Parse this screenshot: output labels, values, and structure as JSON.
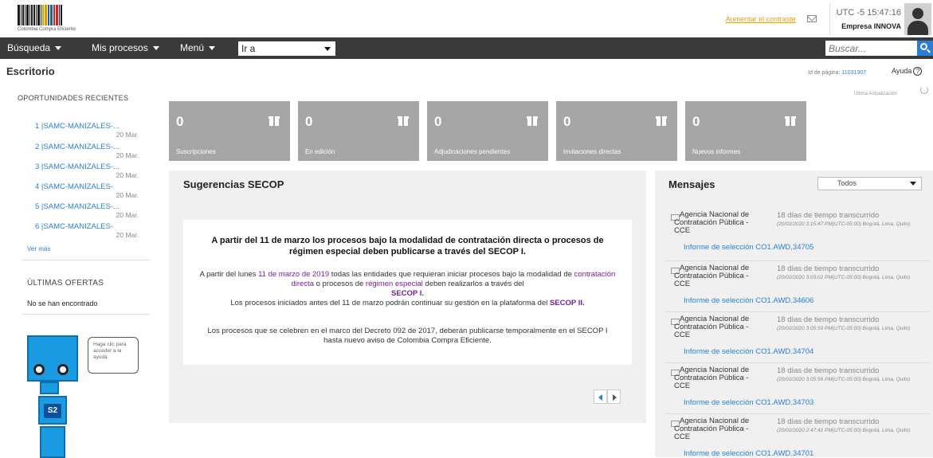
{
  "header": {
    "logo_caption": "Colombia Compra Eficiente",
    "font_link": "Aumentar el contraste",
    "time": "UTC -5 15:47:16",
    "company": "Empresa INNOVA"
  },
  "nav": {
    "items": [
      {
        "label": "Búsqueda"
      },
      {
        "label": "Mis procesos"
      },
      {
        "label": "Menú"
      }
    ],
    "goto_label": "Ir a",
    "search_placeholder": "Buscar..."
  },
  "page": {
    "title": "Escritorio",
    "page_id_label": "Id de página:",
    "page_id": "11031307",
    "help_label": "Ayuda",
    "last_update": "Última Actualización"
  },
  "sidebar": {
    "opportunities_title": "OPORTUNIDADES RECIENTES",
    "opportunities": [
      {
        "label": "1 |SAMC-MANIZALES-...",
        "date": "20 Mar."
      },
      {
        "label": "2 |SAMC-MANIZALES-...",
        "date": "20 Mar."
      },
      {
        "label": "3 |SAMC-MANIZALES-...",
        "date": "20 Mar."
      },
      {
        "label": "4 |SAMC-MANIZALES-",
        "date": "20 Mar."
      },
      {
        "label": "5 |SAMC-MANIZALES-...",
        "date": "20 Mar."
      },
      {
        "label": "6 |SAMC-MANIZALES-",
        "date": "20 Mar."
      }
    ],
    "see_more": "Ver más",
    "latest_offers_title": "ÚLTIMAS OFERTAS",
    "latest_offers_empty": "No se han encontrado",
    "help_bubble": "Haga clic para acceder a la ayuda",
    "robot_badge": "S2"
  },
  "tiles": [
    {
      "count": "0",
      "label": "Suscripciones"
    },
    {
      "count": "0",
      "label": "En edición"
    },
    {
      "count": "0",
      "label": "Adjudicaciones pendientes"
    },
    {
      "count": "0",
      "label": "Invitaciones directas"
    },
    {
      "count": "0",
      "label": "Nuevos informes"
    }
  ],
  "suggestions": {
    "title": "Sugerencias SECOP",
    "headline": "A partir del 11 de marzo los procesos bajo la modalidad de contratación directa o procesos de régimen especial deben publicarse a través del SECOP I.",
    "p1_a": "A partir del lunes ",
    "p1_date": "11 de marzo de 2019",
    "p1_b": " todas las entidades que requieran iniciar procesos bajo la modalidad de ",
    "p1_cd": "contratación directa",
    "p1_c": " o procesos de ",
    "p1_re": "régimen especial",
    "p1_d": " deben realizarlos a través del ",
    "p1_secop1": "SECOP I.",
    "p1_e": "Los procesos iniciados antes del 11 de marzo podrán continuar su gestión en la plataforma del ",
    "p1_secop2": "SECOP II.",
    "p2": "Los procesos que se celebren en el marco del Decreto 092 de 2017, deberán publicarse temporalmente en el SECOP I hasta nuevo aviso de Colombia Compra Eficiente."
  },
  "messages": {
    "title": "Mensajes",
    "filter_value": "Todos",
    "items": [
      {
        "sender": "Agencia Nacional de Contratación Pública - CCE",
        "elapsed": "18 días de tiempo transcurrido",
        "stamp": "(20/02/2020 3:15:47 PM(UTC-05:00) Bogotá, Lima, Quito)",
        "link": "Informe de selección CO1.AWD.34705"
      },
      {
        "sender": "Agencia Nacional de Contratación Pública - CCE",
        "elapsed": "18 días de tiempo transcurrido",
        "stamp": "(20/02/2020 3:03:02 PM(UTC-05:00) Bogotá, Lima, Quito)",
        "link": "Informe de selección CO1.AWD.34606"
      },
      {
        "sender": "Agencia Nacional de Contratación Pública - CCE",
        "elapsed": "18 días de tiempo transcurrido",
        "stamp": "(20/02/2020 3:05:59 PM(UTC-05:00) Bogotá, Lima, Quito)",
        "link": "Informe de selección CO1.AWD.34704"
      },
      {
        "sender": "Agencia Nacional de Contratación Pública - CCE",
        "elapsed": "18 días de tiempo transcurrido",
        "stamp": "(20/02/2020 3:05:56 PM(UTC-05:00) Bogotá, Lima, Quito)",
        "link": "Informe de selección CO1.AWD.34703"
      },
      {
        "sender": "Agencia Nacional de Contratación Pública - CCE",
        "elapsed": "18 días de tiempo transcurrido",
        "stamp": "(20/02/2020 2:47:42 PM(UTC-05:00) Bogotá, Lima, Quito)",
        "link": "Informe de selección CO1.AWD.34701"
      }
    ]
  }
}
